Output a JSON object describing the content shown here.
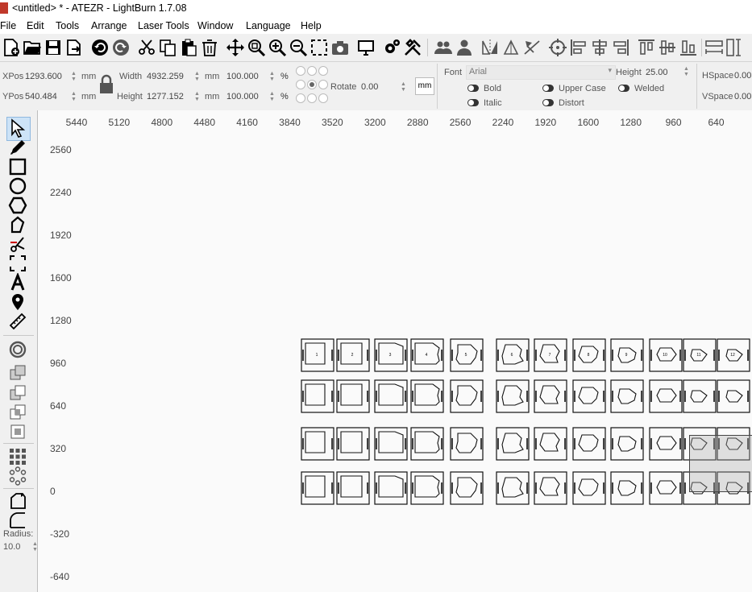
{
  "window": {
    "title": "<untitled> * - ATEZR - LightBurn 1.7.08"
  },
  "menu": [
    "File",
    "Edit",
    "Tools",
    "Arrange",
    "Laser Tools",
    "Window",
    "Language",
    "Help"
  ],
  "props": {
    "xpos_label": "XPos",
    "xpos_value": "1293.600",
    "unit_mm": "mm",
    "ypos_label": "YPos",
    "ypos_value": "540.484",
    "width_label": "Width",
    "width_value": "4932.259",
    "height_label": "Height",
    "height_value": "1277.152",
    "scale_w": "100.000",
    "scale_h": "100.000",
    "percent": "%",
    "rotate_label": "Rotate",
    "rotate_value": "0.00",
    "mm_button": "mm",
    "font_label": "Font",
    "font_value": "Arial",
    "font_height_label": "Height",
    "font_height_value": "25.00",
    "bold": "Bold",
    "italic": "Italic",
    "upper_case": "Upper Case",
    "distort": "Distort",
    "welded": "Welded",
    "hspace_label": "HSpace",
    "hspace_value": "0.00",
    "vspace_label": "VSpace",
    "vspace_value": "0.00"
  },
  "left_tools": {
    "radius_label": "Radius:",
    "radius_value": "10.0"
  },
  "ruler": {
    "x_ticks": [
      "5440",
      "5120",
      "4800",
      "4480",
      "4160",
      "3840",
      "3520",
      "3200",
      "2880",
      "2560",
      "2240",
      "1920",
      "1600",
      "1280",
      "960",
      "640"
    ],
    "y_ticks": [
      "2560",
      "2240",
      "1920",
      "1600",
      "1280",
      "960",
      "640",
      "320",
      "0",
      "-320",
      "-640"
    ]
  },
  "pieces": {
    "top_row_numbers": [
      "1",
      "2",
      "3",
      "4",
      "5",
      "6",
      "7",
      "8",
      "9",
      "10",
      "11",
      "12"
    ]
  }
}
